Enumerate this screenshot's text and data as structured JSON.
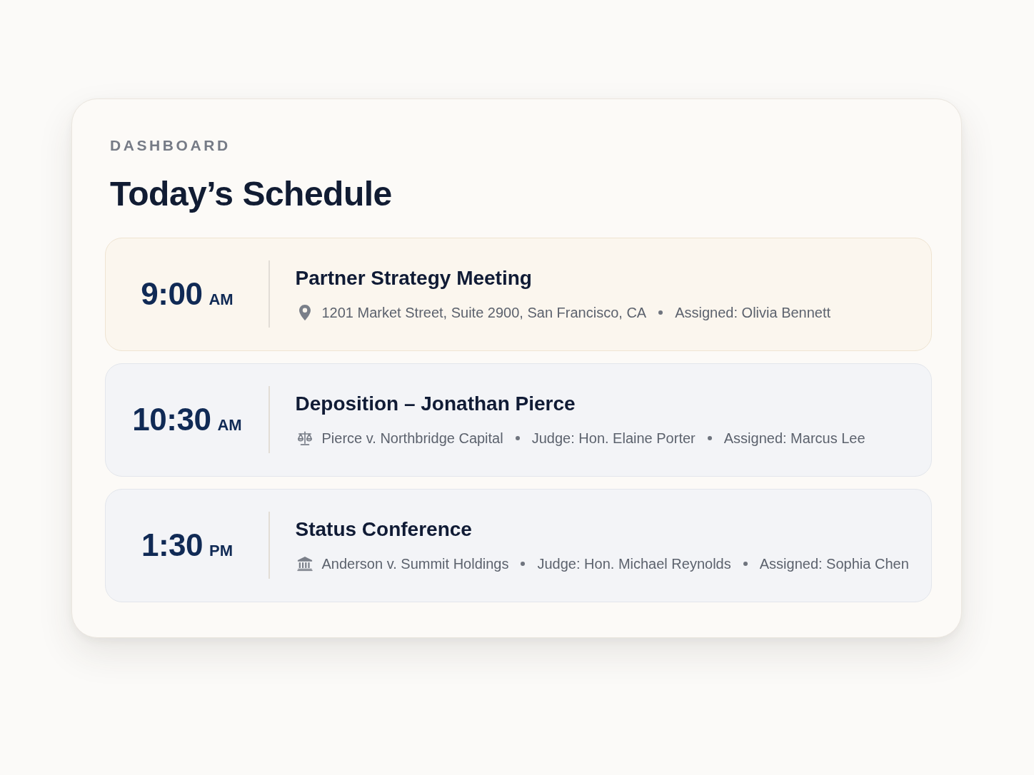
{
  "card": {
    "eyebrow": "DASHBOARD",
    "title": "Today’s Schedule"
  },
  "events": [
    {
      "time": "9:00",
      "period": "AM",
      "title": "Partner Strategy Meeting",
      "highlighted": true,
      "kind": "location",
      "details": [
        "1201 Market Street, Suite 2900, San Francisco, CA",
        "Assigned: Olivia Bennett"
      ]
    },
    {
      "time": "10:30",
      "period": "AM",
      "title": "Deposition – Jonathan Pierce",
      "highlighted": false,
      "kind": "case",
      "details": [
        "Pierce v. Northbridge Capital",
        "Judge: Hon. Elaine Porter",
        "Assigned: Marcus Lee"
      ]
    },
    {
      "time": "1:30",
      "period": "PM",
      "title": "Status Conference",
      "highlighted": false,
      "kind": "court",
      "details": [
        "Anderson v. Summit Holdings",
        "Judge: Hon. Michael Reynolds",
        "Assigned: Sophia Chen"
      ]
    }
  ]
}
